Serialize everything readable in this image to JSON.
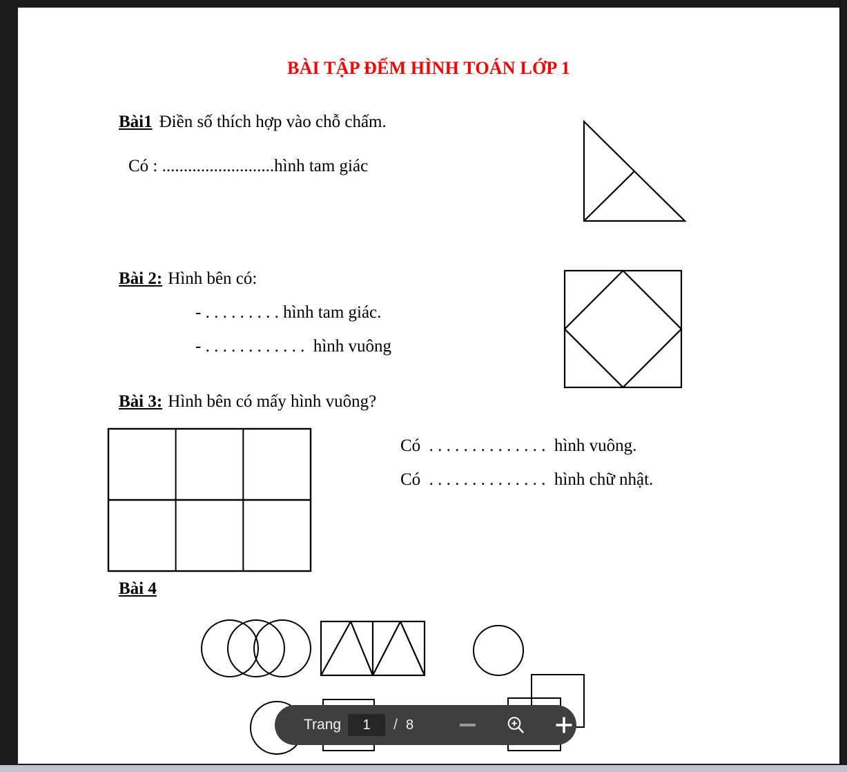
{
  "document": {
    "title": "BÀI TẬP ĐẾM HÌNH TOÁN LỚP 1",
    "title_color": "#ff0000",
    "exercises": [
      {
        "label": "Bài1",
        "prompt": "Điền số thích hợp vào chỗ chấm.",
        "answer_line": "Có : ..........................hình tam giác"
      },
      {
        "label": "Bài 2:",
        "prompt": "Hình bên có:",
        "bullet1": "- . . . . . . . . . hình tam giác.",
        "bullet2": "- . . . . . . . . . . . .  hình vuông"
      },
      {
        "label": "Bài 3:",
        "prompt": "Hình bên có mấy hình vuông?",
        "answer1": "Có  . . . . . . . . . . . . . .  hình vuông.",
        "answer2": "Có  . . . . . . . . . . . . . .  hình chữ nhật."
      },
      {
        "label": "Bài 4"
      }
    ],
    "figures": [
      {
        "name": "right-triangle-with-median",
        "exercise": "Bài1"
      },
      {
        "name": "square-with-inscribed-diamond",
        "exercise": "Bài 2"
      },
      {
        "name": "three-by-two-grid",
        "exercise": "Bài 3"
      },
      {
        "name": "three-overlapping-circles",
        "exercise": "Bài 4"
      },
      {
        "name": "rectangle-with-two-triangles",
        "exercise": "Bài 4"
      },
      {
        "name": "single-circle-right",
        "exercise": "Bài 4"
      },
      {
        "name": "two-overlapping-squares",
        "exercise": "Bài 4"
      },
      {
        "name": "single-circle-bottom-left",
        "exercise": "Bài 4"
      },
      {
        "name": "single-square-bottom",
        "exercise": "Bài 4"
      }
    ]
  },
  "toolbar": {
    "page_label": "Trang",
    "current_page": "1",
    "page_placeholder": "1",
    "separator": "/",
    "total_pages": "8",
    "zoom_out_icon": "minus-icon",
    "zoom_search_icon": "zoom-in-magnifier-icon",
    "zoom_in_icon": "plus-icon",
    "background": "#3f3f3f"
  }
}
